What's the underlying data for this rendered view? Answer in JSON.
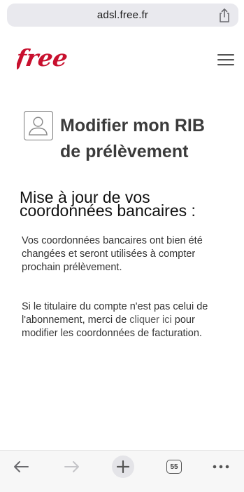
{
  "browser": {
    "url": "adsl.free.fr",
    "tab_count": "55"
  },
  "header": {
    "logo_text": "free",
    "brand_color": "#c8102e"
  },
  "page": {
    "title_line1": "Modifier mon RIB",
    "title_line2": "de prélèvement",
    "subtitle_line1": "Mise à jour de vos",
    "subtitle_line2": "coordonnées bancaires :",
    "paragraph1": "Vos coordonnées bancaires ont bien été changées et seront utilisées à compter prochain prélèvement.",
    "paragraph2_before": "Si le titulaire du compte n'est pas celui de l'abonnement, merci de ",
    "paragraph2_link": "cliquer ici",
    "paragraph2_after": " pour modifier les coordonnées de facturation."
  },
  "icons": {
    "share": "share-icon",
    "menu": "hamburger-menu-icon",
    "avatar": "user-avatar-icon",
    "back": "back-arrow-icon",
    "forward": "forward-arrow-icon",
    "new_tab": "plus-icon",
    "tabs": "tabs-icon",
    "more": "more-icon"
  }
}
